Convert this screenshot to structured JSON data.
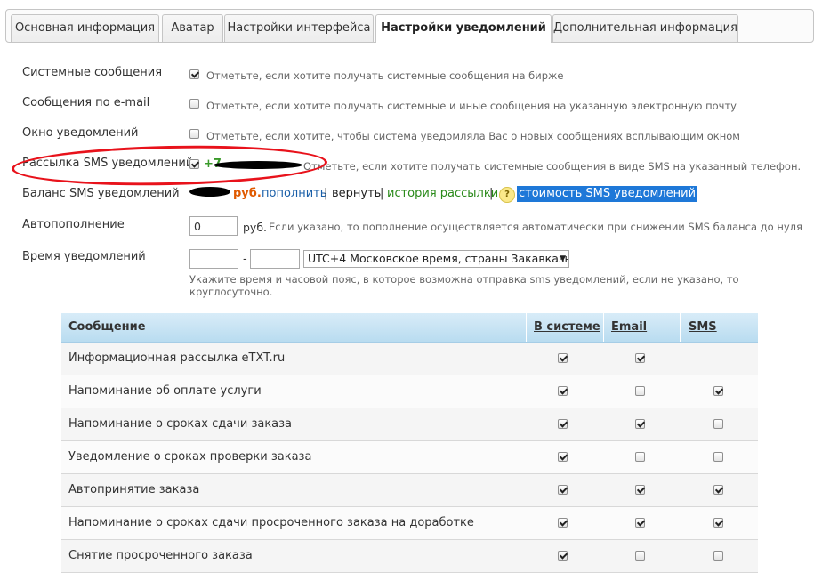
{
  "tabs": [
    {
      "label": "Основная информация"
    },
    {
      "label": "Аватар"
    },
    {
      "label": "Настройки интерфейса"
    },
    {
      "label": "Настройки уведомлений"
    },
    {
      "label": "Дополнительная информация"
    }
  ],
  "settings": {
    "system_label": "Системные сообщения",
    "system_hint": "Отметьте, если хотите получать системные сообщения на бирже",
    "system_checked": true,
    "email_label": "Сообщения по e-mail",
    "email_hint": "Отметьте, если хотите получать системные и иные сообщения на указанную электронную почту",
    "email_checked": false,
    "popup_label": "Окно уведомлений",
    "popup_hint": "Отметьте, если хотите, чтобы система уведомляла Вас о новых сообщениях всплывающим окном",
    "popup_checked": false,
    "sms_label": "Рассылка SMS уведомлений",
    "sms_phone": "+7",
    "sms_hint": "Отметьте, если хотите получать системные сообщения в виде SMS на указанный телефон.",
    "sms_checked": true,
    "balance_label": "Баланс SMS уведомлений",
    "balance_currency": "руб.",
    "link_topup": "пополнить",
    "link_return": "вернуть",
    "link_history": "история рассылки",
    "help_icon_text": "?",
    "link_cost": "стоимость SMS уведомлений",
    "auto_label": "Автопополнение",
    "auto_value": "0",
    "auto_currency": "руб.",
    "auto_hint": "Если указано, то пополнение осуществляется автоматически при снижении SMS баланса до нуля",
    "time_label": "Время уведомлений",
    "time_from": "",
    "time_dash": "-",
    "time_to": "",
    "timezone_selected": "UTC+4 Московское время, страны Закавказья",
    "time_hint_line1": "Укажите время и часовой пояс, в которое возможна отправка sms уведомлений, если не указано, то",
    "time_hint_line2": "круглосуточно."
  },
  "table": {
    "headers": {
      "message": "Сообщение",
      "system": "В системе",
      "email": "Email",
      "sms": "SMS"
    },
    "rows": [
      {
        "message": "Информационная рассылка eTXT.ru",
        "system": true,
        "email": true,
        "sms": null
      },
      {
        "message": "Напоминание об оплате услуги",
        "system": true,
        "email": false,
        "sms": true
      },
      {
        "message": "Напоминание о сроках сдачи заказа",
        "system": true,
        "email": true,
        "sms": false
      },
      {
        "message": "Уведомление о сроках проверки заказа",
        "system": true,
        "email": false,
        "sms": false
      },
      {
        "message": "Автопринятие заказа",
        "system": true,
        "email": true,
        "sms": true
      },
      {
        "message": "Напоминание о сроках сдачи просроченного заказа на доработке",
        "system": true,
        "email": true,
        "sms": true
      },
      {
        "message": "Снятие просроченного заказа",
        "system": true,
        "email": false,
        "sms": false
      }
    ]
  },
  "colors": {
    "annotation": "#e8121b",
    "selection": "#1e78d8",
    "header_bg": "#c9e4f4",
    "phone": "#3a9a2a",
    "rub": "#e05a00"
  }
}
